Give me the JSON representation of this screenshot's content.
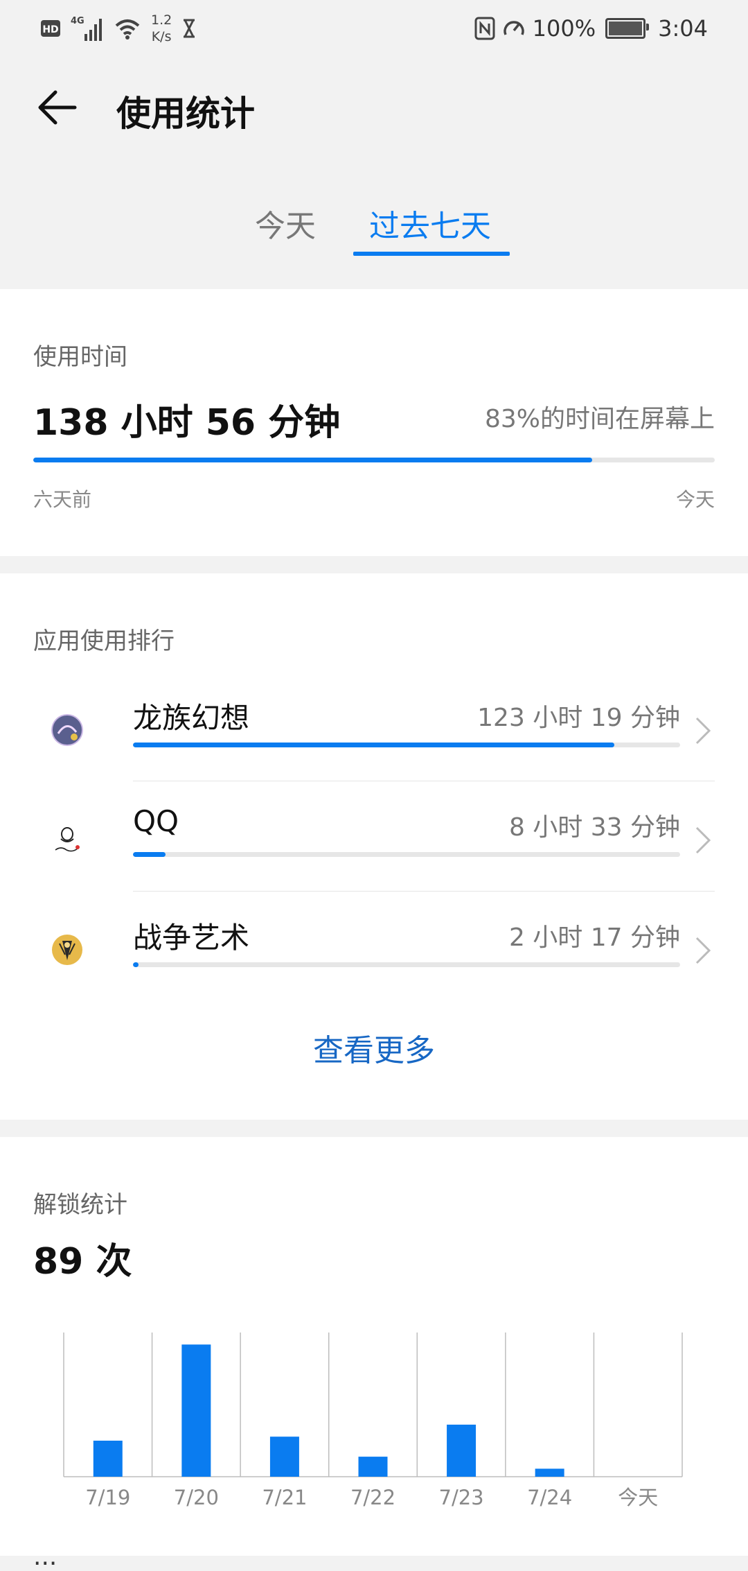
{
  "status_bar": {
    "hd": "HD",
    "network": "4G",
    "speed_value": "1.2",
    "speed_unit": "K/s",
    "battery": "100%",
    "time": "3:04"
  },
  "header": {
    "title": "使用统计"
  },
  "tabs": [
    {
      "label": "今天",
      "selected": false
    },
    {
      "label": "过去七天",
      "selected": true
    }
  ],
  "usage": {
    "label": "使用时间",
    "total": "138 小时 56 分钟",
    "screen_pct_text": "83%的时间在屏幕上",
    "progress_fraction": 0.82,
    "start_label": "六天前",
    "end_label": "今天"
  },
  "ranking": {
    "label": "应用使用排行",
    "apps": [
      {
        "name": "龙族幻想",
        "time": "123 小时 19 分钟",
        "fraction": 0.88,
        "icon": "dragon-app-icon"
      },
      {
        "name": "QQ",
        "time": "8 小时 33 分钟",
        "fraction": 0.06,
        "icon": "qq-penguin-icon"
      },
      {
        "name": "战争艺术",
        "time": "2 小时 17 分钟",
        "fraction": 0.01,
        "icon": "art-of-war-icon"
      }
    ],
    "more": "查看更多"
  },
  "unlock": {
    "label": "解锁统计",
    "count": "89 次"
  },
  "chart_data": {
    "type": "bar",
    "categories": [
      "7/19",
      "7/20",
      "7/21",
      "7/22",
      "7/23",
      "7/24",
      "今天"
    ],
    "values": [
      9,
      33,
      10,
      5,
      13,
      2,
      0
    ],
    "ylim": [
      0,
      36
    ],
    "grid": true
  },
  "peek_text": "..."
}
